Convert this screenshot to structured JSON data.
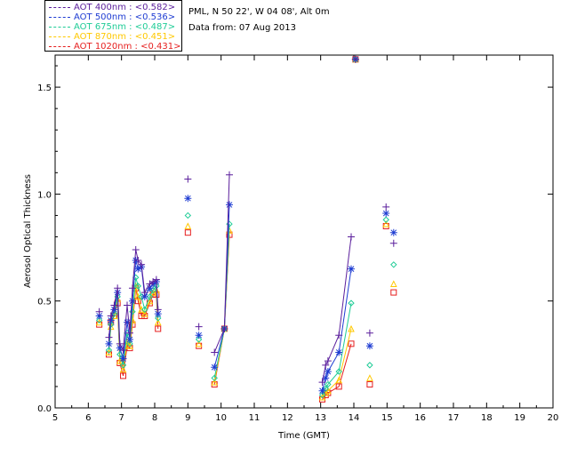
{
  "header": {
    "station": "PML, N 50 22', W 04 08', Alt 0m",
    "date": "Data from: 07 Aug 2013"
  },
  "legend": [
    {
      "label": "AOT  400nm : <0.582>",
      "color": "#5a1e9c"
    },
    {
      "label": "AOT  500nm : <0.536>",
      "color": "#1e3cd2"
    },
    {
      "label": "AOT  675nm : <0.487>",
      "color": "#1ecc96"
    },
    {
      "label": "AOT  870nm : <0.451>",
      "color": "#ffc800"
    },
    {
      "label": "AOT 1020nm : <0.431>",
      "color": "#e61e1e"
    }
  ],
  "chart_data": {
    "type": "line",
    "xlabel": "Time (GMT)",
    "ylabel": "Aerosol Optical Thickness",
    "xlim": [
      5,
      20
    ],
    "ylim": [
      0,
      1.65
    ],
    "xticks": [
      5,
      6,
      7,
      8,
      9,
      10,
      11,
      12,
      13,
      14,
      15,
      16,
      17,
      18,
      19,
      20
    ],
    "yticks": [
      0.0,
      0.5,
      1.0,
      1.5
    ],
    "ytick_labels": [
      "0.0",
      "0.5",
      "1.0",
      "1.5"
    ],
    "x": [
      6.33,
      6.62,
      6.68,
      6.78,
      6.88,
      6.95,
      7.05,
      7.17,
      7.25,
      7.33,
      7.43,
      7.5,
      7.6,
      7.7,
      7.85,
      7.95,
      8.05,
      8.1,
      9.0,
      9.33,
      9.8,
      10.1,
      10.25,
      13.05,
      13.15,
      13.22,
      13.55,
      13.92,
      14.05,
      14.48,
      14.97,
      15.2
    ],
    "segments": [
      [
        0,
        1
      ],
      [
        1,
        18
      ],
      [
        18,
        19
      ],
      [
        19,
        20
      ],
      [
        20,
        23
      ],
      [
        23,
        28
      ],
      [
        28,
        29
      ],
      [
        29,
        30
      ],
      [
        30,
        31
      ],
      [
        31,
        32
      ]
    ],
    "series": [
      {
        "name": "AOT  400nm : <0.582>",
        "marker": "plus",
        "color": "#5a1e9c",
        "values": [
          0.45,
          0.33,
          0.43,
          0.48,
          0.56,
          0.3,
          0.27,
          0.48,
          0.35,
          0.56,
          0.74,
          0.69,
          0.67,
          0.54,
          0.58,
          0.59,
          0.6,
          0.46,
          1.07,
          0.38,
          0.26,
          0.37,
          1.09,
          0.12,
          0.2,
          0.22,
          0.34,
          0.8,
          1.63,
          0.35,
          0.94,
          0.77
        ]
      },
      {
        "name": "AOT  500nm : <0.536>",
        "marker": "asterisk",
        "color": "#1e3cd2",
        "values": [
          0.43,
          0.3,
          0.41,
          0.46,
          0.54,
          0.28,
          0.23,
          0.4,
          0.32,
          0.5,
          0.69,
          0.65,
          0.66,
          0.52,
          0.56,
          0.58,
          0.59,
          0.44,
          0.98,
          0.34,
          0.19,
          0.37,
          0.95,
          0.08,
          0.14,
          0.17,
          0.26,
          0.65,
          1.63,
          0.29,
          0.91,
          0.82
        ]
      },
      {
        "name": "AOT  675nm : <0.487>",
        "marker": "diamond",
        "color": "#1ecc96",
        "values": [
          0.41,
          0.27,
          0.39,
          0.44,
          0.52,
          0.25,
          0.2,
          0.35,
          0.3,
          0.45,
          0.61,
          0.57,
          0.52,
          0.46,
          0.52,
          0.55,
          0.57,
          0.42,
          0.9,
          0.32,
          0.14,
          0.37,
          0.86,
          0.06,
          0.09,
          0.11,
          0.17,
          0.49,
          1.63,
          0.2,
          0.88,
          0.67
        ]
      },
      {
        "name": "AOT  870nm : <0.451>",
        "marker": "triangle",
        "color": "#ffc800",
        "values": [
          0.4,
          0.26,
          0.38,
          0.43,
          0.51,
          0.22,
          0.18,
          0.31,
          0.29,
          0.41,
          0.57,
          0.52,
          0.46,
          0.44,
          0.5,
          0.54,
          0.55,
          0.4,
          0.85,
          0.3,
          0.12,
          0.37,
          0.83,
          0.05,
          0.07,
          0.08,
          0.13,
          0.37,
          1.63,
          0.14,
          0.86,
          0.58
        ]
      },
      {
        "name": "AOT 1020nm : <0.431>",
        "marker": "square",
        "color": "#e61e1e",
        "values": [
          0.39,
          0.25,
          0.4,
          0.43,
          0.49,
          0.21,
          0.15,
          0.29,
          0.28,
          0.39,
          0.56,
          0.5,
          0.43,
          0.43,
          0.49,
          0.53,
          0.53,
          0.37,
          0.82,
          0.29,
          0.11,
          0.37,
          0.81,
          0.04,
          0.06,
          0.07,
          0.1,
          0.3,
          1.63,
          0.11,
          0.85,
          0.54
        ]
      }
    ]
  }
}
